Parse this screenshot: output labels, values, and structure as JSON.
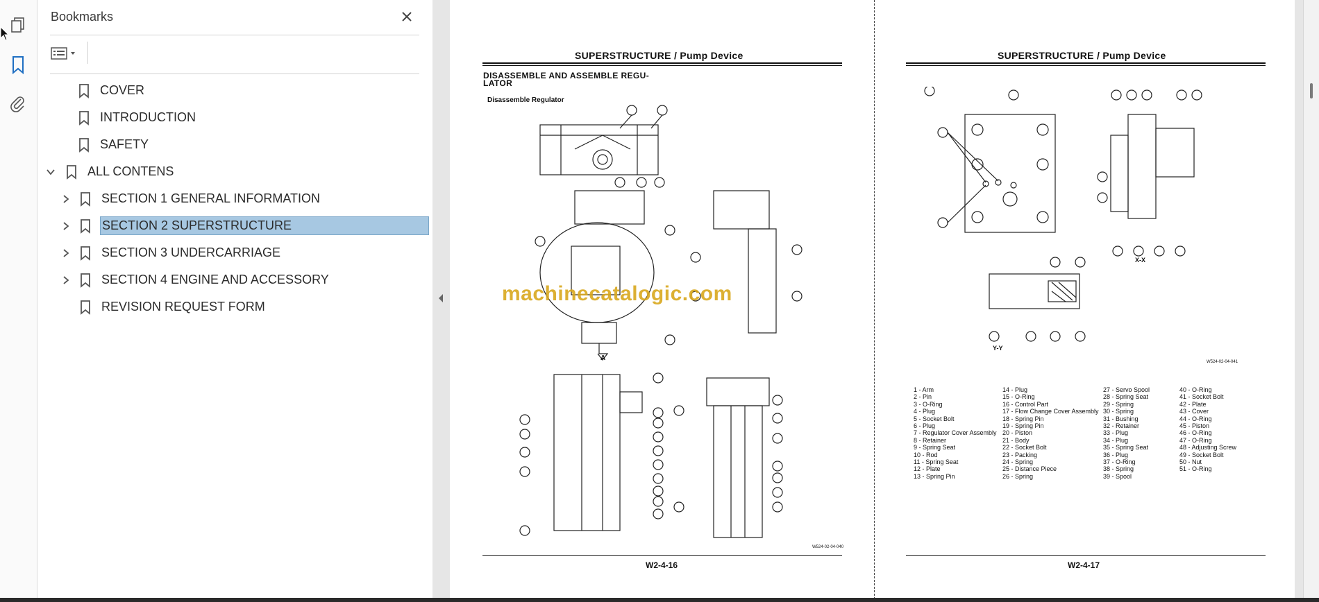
{
  "rail": {
    "icons": [
      "pages-icon",
      "bookmark-icon",
      "attachment-icon"
    ]
  },
  "bookmarks": {
    "title": "Bookmarks",
    "items": [
      {
        "label": "COVER"
      },
      {
        "label": "INTRODUCTION"
      },
      {
        "label": "SAFETY"
      },
      {
        "label": "ALL CONTENS"
      },
      {
        "label": "SECTION 1 GENERAL INFORMATION"
      },
      {
        "label": "SECTION 2 SUPERSTRUCTURE"
      },
      {
        "label": "SECTION 3 UNDERCARRIAGE"
      },
      {
        "label": "SECTION 4 ENGINE AND ACCESSORY"
      },
      {
        "label": "REVISION REQUEST FORM"
      }
    ]
  },
  "left_page": {
    "header": "SUPERSTRUCTURE / Pump Device",
    "section_title_1": "DISASSEMBLE AND ASSEMBLE REGU-",
    "section_title_2": "LATOR",
    "subtitle": "Disassemble Regulator",
    "fig_code": "W2-4-16",
    "fig_id": "W524-02-04-040",
    "view_label": "A"
  },
  "right_page": {
    "header": "SUPERSTRUCTURE / Pump Device",
    "fig_code": "W2-4-17",
    "fig_id": "W524-02-04-041",
    "view_xx": "X-X",
    "view_yy": "Y-Y",
    "parts_col1": [
      "1 -   Arm",
      "2 -   Pin",
      "3 -   O-Ring",
      "4 -   Plug",
      "5 -   Socket Bolt",
      "6 -   Plug",
      "7 -   Regulator Cover Assembly",
      "8 -   Retainer",
      "9 -   Spring Seat",
      "10 - Rod",
      "11 - Spring Seat",
      "12 - Plate",
      "13 - Spring Pin"
    ],
    "parts_col2": [
      "14 - Plug",
      "15 - O-Ring",
      "16 - Control Part",
      "17 - Flow Change Cover Assembly",
      "18 - Spring Pin",
      "19 - Spring Pin",
      "20 - Piston",
      "21 - Body",
      "22 - Socket Bolt",
      "23 - Packing",
      "24 - Spring",
      "25 - Distance Piece",
      "26 - Spring"
    ],
    "parts_col3": [
      "27 - Servo Spool",
      "28 - Spring Seat",
      "29 - Spring",
      "30 - Spring",
      "31 - Bushing",
      "32 - Retainer",
      "33 - Plug",
      "34 - Plug",
      "35 - Spring Seat",
      "36 - Plug",
      "37 - O-Ring",
      "38 - Spring",
      "39 - Spool"
    ],
    "parts_col4": [
      "40 - O-Ring",
      "41 - Socket Bolt",
      "42 - Plate",
      "43 - Cover",
      "44 - O-Ring",
      "45 - Piston",
      "46 - O-Ring",
      "47 - O-Ring",
      "48 - Adjusting Screw",
      "49 - Socket Bolt",
      "50 - Nut",
      "51 - O-Ring"
    ]
  },
  "watermark": "machinecatalogic.com"
}
